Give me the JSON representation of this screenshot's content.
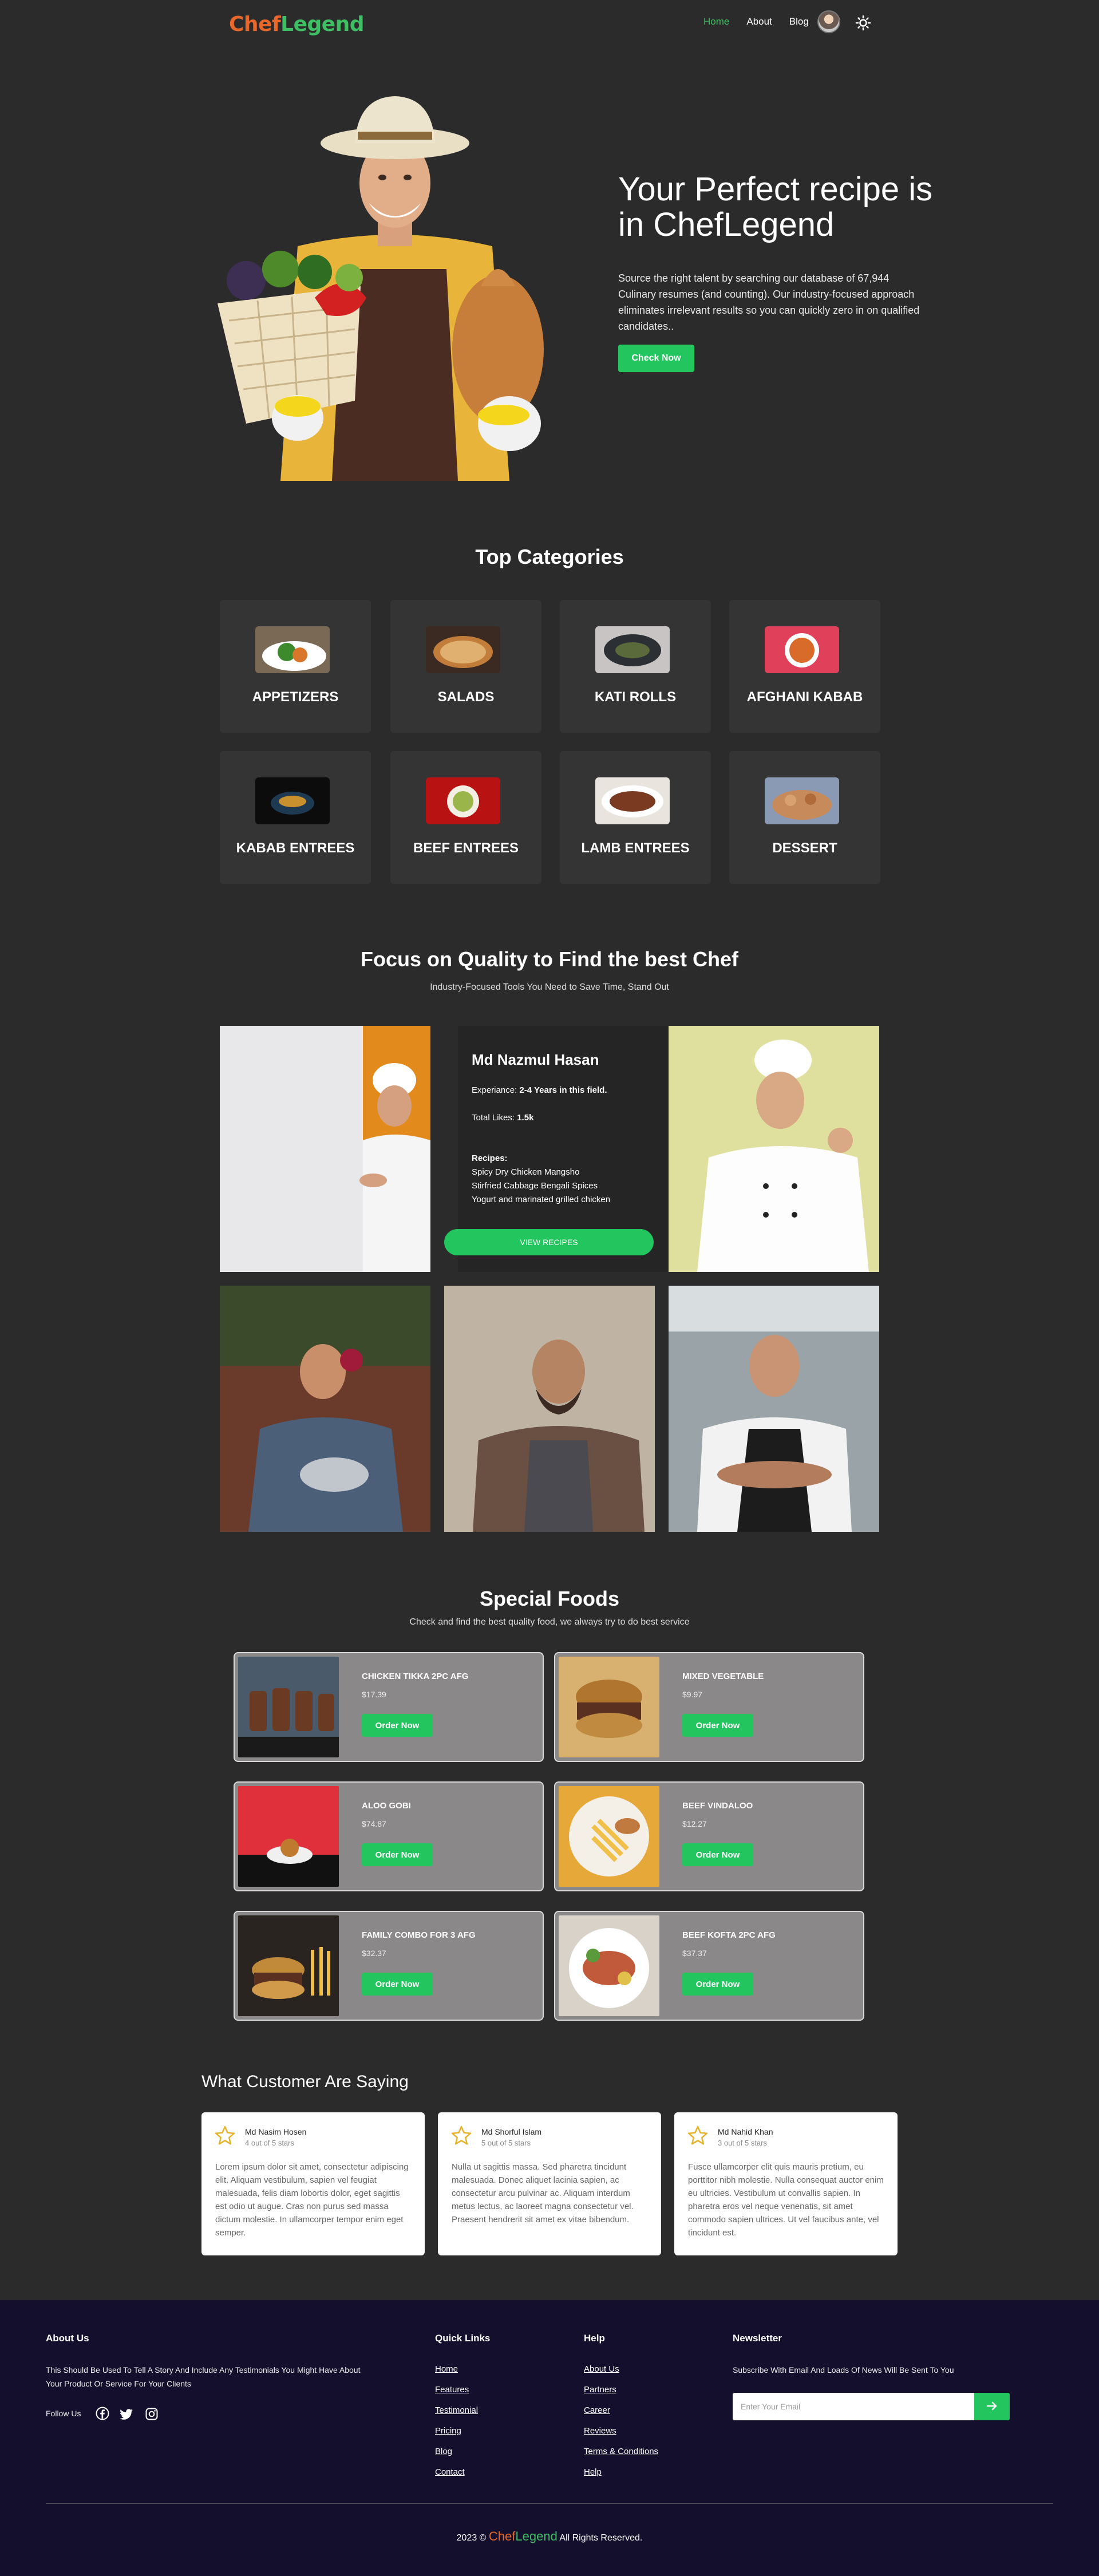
{
  "nav": {
    "logo_part1": "Chef",
    "logo_part2": "Legend",
    "links": [
      "Home",
      "About",
      "Blog"
    ],
    "active_link": "Home"
  },
  "hero": {
    "title": "Your Perfect recipe is in ChefLegend",
    "text": "Source the right talent by searching our database of 67,944 Culinary resumes (and counting). Our industry-focused approach eliminates irrelevant results so you can quickly zero in on qualified candidates..",
    "button": "Check Now"
  },
  "categories": {
    "title": "Top Categories",
    "items": [
      "APPETIZERS",
      "SALADS",
      "KATI ROLLS",
      "AFGHANI KABAB",
      "KABAB ENTREES",
      "BEEF ENTREES",
      "LAMB ENTREES",
      "DESSERT"
    ]
  },
  "chefs": {
    "title": "Focus on Quality to Find the best Chef",
    "subtitle": "Industry-Focused Tools You Need to Save Time, Stand Out",
    "featured": {
      "name": "Md Nazmul Hasan",
      "experience_label": "Experiance:",
      "experience_value": "2-4 Years in this field.",
      "likes_label": "Total Likes:",
      "likes_value": "1.5k",
      "recipes_label": "Recipes:",
      "recipes": [
        "Spicy Dry Chicken Mangsho",
        "Stirfried Cabbage Bengali Spices",
        "Yogurt and marinated grilled chicken"
      ],
      "button": "VIEW RECIPES"
    }
  },
  "special_foods": {
    "title": "Special Foods",
    "subtitle": "Check and find the best quality food, we always try to do best service",
    "order_label": "Order Now",
    "items": [
      {
        "name": "Chicken tikka 2pc afg",
        "price": "$17.39"
      },
      {
        "name": "MIXED VEGETABLE",
        "price": "$9.97"
      },
      {
        "name": "Aloo GOBI",
        "price": "$74.87"
      },
      {
        "name": "BEEF VINDALOO",
        "price": "$12.27"
      },
      {
        "name": "FAMILY COMBO FOR 3 AFG",
        "price": "$32.37"
      },
      {
        "name": "Beef kofta 2pc afg",
        "price": "$37.37"
      }
    ]
  },
  "testimonials": {
    "title": "What Customer Are Saying",
    "items": [
      {
        "name": "Md Nasim Hosen",
        "rating": "4 out of 5 stars",
        "text": "Lorem ipsum dolor sit amet, consectetur adipiscing elit. Aliquam vestibulum, sapien vel feugiat malesuada, felis diam lobortis dolor, eget sagittis est odio ut augue. Cras non purus sed massa dictum molestie. In ullamcorper tempor enim eget semper."
      },
      {
        "name": "Md Shorful Islam",
        "rating": "5 out of 5 stars",
        "text": "Nulla ut sagittis massa. Sed pharetra tincidunt malesuada. Donec aliquet lacinia sapien, ac consectetur arcu pulvinar ac. Aliquam interdum metus lectus, ac laoreet magna consectetur vel. Praesent hendrerit sit amet ex vitae bibendum."
      },
      {
        "name": "Md Nahid Khan",
        "rating": "3 out of 5 stars",
        "text": "Fusce ullamcorper elit quis mauris pretium, eu porttitor nibh molestie. Nulla consequat auctor enim eu ultricies. Vestibulum ut convallis sapien. In pharetra eros vel neque venenatis, sit amet commodo sapien ultrices. Ut vel faucibus ante, vel tincidunt est."
      }
    ]
  },
  "footer": {
    "about_title": "About Us",
    "about_text": "This Should Be Used To Tell A Story And Include Any Testimonials You Might Have About Your Product Or Service For Your Clients",
    "follow_label": "Follow Us",
    "quick_links_title": "Quick Links",
    "quick_links": [
      "Home",
      "Features",
      "Testimonial",
      "Pricing",
      "Blog",
      "Contact"
    ],
    "help_title": "Help",
    "help_links": [
      "About Us",
      "Partners",
      "Career",
      "Reviews",
      "Terms & Conditions",
      "Help"
    ],
    "newsletter_title": "Newsletter",
    "newsletter_text": "Subscribe With Email And Loads Of News Will Be Sent To You",
    "email_placeholder": "Enter Your Email",
    "copyright_prefix": "2023 ©",
    "copyright_brand1": "Chef",
    "copyright_brand2": "Legend",
    "copyright_suffix": "All Rights Reserved."
  },
  "colors": {
    "background": "#2c2b2b",
    "accent_green": "#22c55e",
    "logo_orange": "#e8672a",
    "footer_bg": "#140f2c"
  },
  "icons": [
    "sun-icon",
    "facebook-icon",
    "twitter-icon",
    "instagram-icon",
    "star-icon",
    "arrow-right-icon"
  ]
}
